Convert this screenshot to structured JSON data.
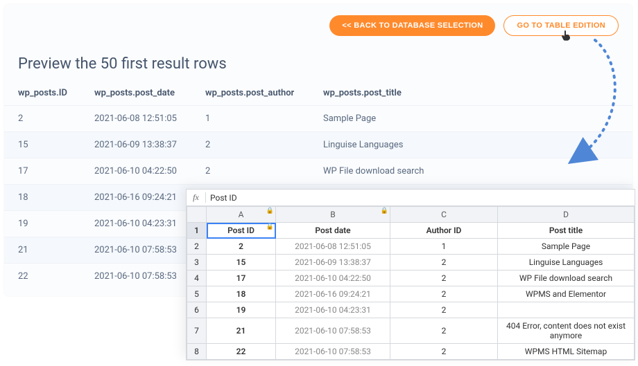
{
  "buttons": {
    "back": "<< BACK TO DATABASE SELECTION",
    "edit": "GO TO TABLE EDITION"
  },
  "preview": {
    "title": "Preview the 50 first result rows",
    "columns": [
      "wp_posts.ID",
      "wp_posts.post_date",
      "wp_posts.post_author",
      "wp_posts.post_title"
    ],
    "rows": [
      {
        "id": "2",
        "date": "2021-06-08 12:51:05",
        "author": "1",
        "title": "Sample Page"
      },
      {
        "id": "15",
        "date": "2021-06-09 13:38:37",
        "author": "2",
        "title": "Linguise Languages"
      },
      {
        "id": "17",
        "date": "2021-06-10 04:22:50",
        "author": "2",
        "title": "WP File download search"
      },
      {
        "id": "18",
        "date": "2021-06-16 09:24:21",
        "author": "2",
        "title": "WPMS and Elementor"
      },
      {
        "id": "19",
        "date": "2021-06-10 04:23:31",
        "author": "",
        "title": ""
      },
      {
        "id": "21",
        "date": "2021-06-10 07:58:53",
        "author": "",
        "title": ""
      },
      {
        "id": "22",
        "date": "2021-06-10 07:58:53",
        "author": "",
        "title": ""
      }
    ]
  },
  "sheet": {
    "fx_label": "fx",
    "fx_value": "Post ID",
    "letters": [
      "A",
      "B",
      "C",
      "D"
    ],
    "header": [
      "Post ID",
      "Post date",
      "Author ID",
      "Post title"
    ],
    "rows": [
      {
        "n": "2",
        "id": "2",
        "date": "2021-06-08 12:51:05",
        "author": "1",
        "title": "Sample Page"
      },
      {
        "n": "3",
        "id": "15",
        "date": "2021-06-09 13:38:37",
        "author": "2",
        "title": "Linguise Languages"
      },
      {
        "n": "4",
        "id": "17",
        "date": "2021-06-10 04:22:50",
        "author": "2",
        "title": "WP File download search"
      },
      {
        "n": "5",
        "id": "18",
        "date": "2021-06-16 09:24:21",
        "author": "2",
        "title": "WPMS and Elementor"
      },
      {
        "n": "6",
        "id": "19",
        "date": "2021-06-10 04:23:31",
        "author": "2",
        "title": ""
      },
      {
        "n": "7",
        "id": "21",
        "date": "2021-06-10 07:58:53",
        "author": "2",
        "title": "404 Error, content does not exist anymore"
      },
      {
        "n": "8",
        "id": "22",
        "date": "2021-06-10 07:58:53",
        "author": "2",
        "title": "WPMS HTML Sitemap"
      }
    ]
  }
}
